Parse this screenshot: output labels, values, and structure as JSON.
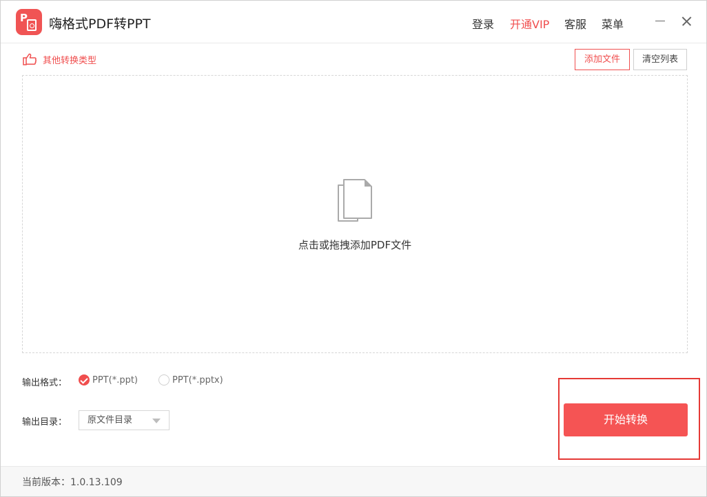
{
  "app": {
    "title": "嗨格式PDF转PPT",
    "logo_letter": "P"
  },
  "nav": {
    "login": "登录",
    "vip": "开通VIP",
    "service": "客服",
    "menu": "菜单"
  },
  "toolbar": {
    "other_types": "其他转换类型",
    "add_file": "添加文件",
    "clear_list": "清空列表"
  },
  "dropzone": {
    "hint": "点击或拖拽添加PDF文件"
  },
  "options": {
    "format_label": "输出格式：",
    "formats": [
      {
        "label": "PPT(*.ppt)",
        "checked": true
      },
      {
        "label": "PPT(*.pptx)",
        "checked": false
      }
    ],
    "dir_label": "输出目录：",
    "dir_value": "原文件目录"
  },
  "actions": {
    "start": "开始转换"
  },
  "footer": {
    "version": "当前版本：1.0.13.109"
  },
  "colors": {
    "accent": "#f04e4e",
    "button": "#f55454",
    "highlight": "#e53935"
  }
}
